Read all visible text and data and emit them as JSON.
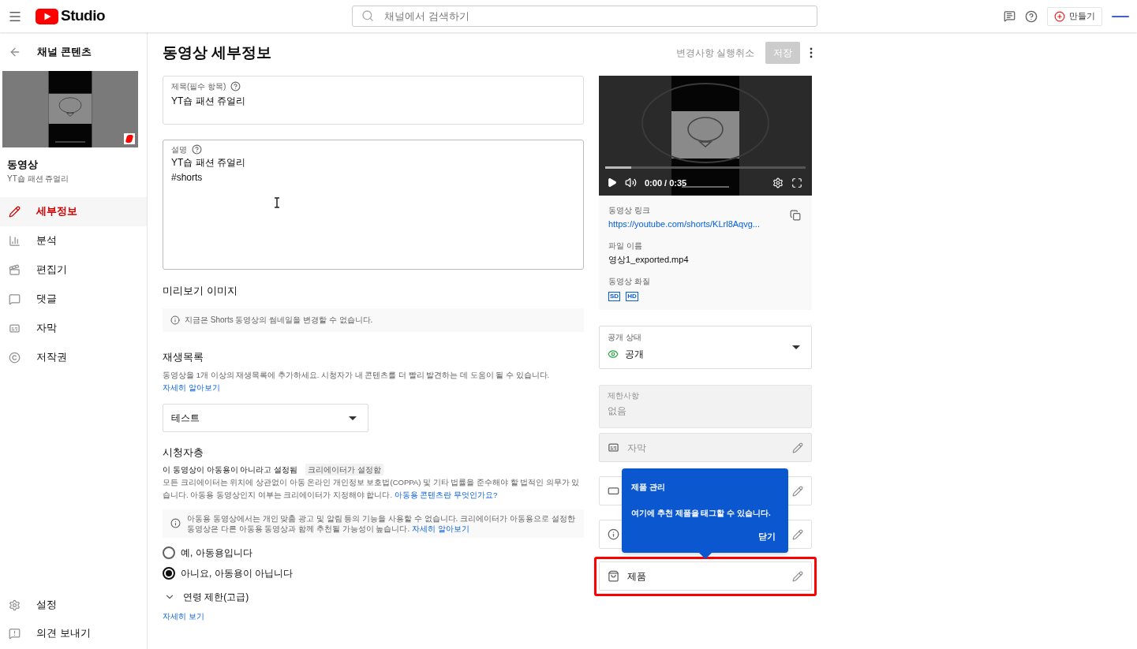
{
  "header": {
    "logo_text": "Studio",
    "search": {
      "placeholder": "채널에서 검색하기"
    },
    "create_button": "만들기"
  },
  "sidebar": {
    "back_label": "채널 콘텐츠",
    "video_label": "동영상",
    "video_title": "YT숍 패션 쥬얼리",
    "items": [
      {
        "kind": "details",
        "label": "세부정보",
        "selected": true
      },
      {
        "kind": "analytics",
        "label": "분석",
        "selected": false
      },
      {
        "kind": "editor",
        "label": "편집기",
        "selected": false
      },
      {
        "kind": "comments",
        "label": "댓글",
        "selected": false
      },
      {
        "kind": "subtitles",
        "label": "자막",
        "selected": false
      },
      {
        "kind": "copyright",
        "label": "저작권",
        "selected": false
      }
    ],
    "bottom_items": [
      {
        "kind": "settings",
        "label": "설정"
      },
      {
        "kind": "feedback",
        "label": "의견 보내기"
      }
    ]
  },
  "page": {
    "title": "동영상 세부정보",
    "undo_button": "변경사항 실행취소",
    "save_button": {
      "label": "저장",
      "disabled": true
    }
  },
  "title_field": {
    "label": "제목(필수 항목)",
    "value": "YT숍 패션 쥬얼리"
  },
  "description_field": {
    "label": "설명",
    "lines": [
      "YT숍 패션 쥬얼리",
      "#shorts"
    ]
  },
  "thumbnail_section": {
    "heading": "미리보기 이미지",
    "notice": "지금은 Shorts 동영상의 썸네일을 변경할 수 없습니다."
  },
  "playlist_section": {
    "heading": "재생목록",
    "description": "동영상을 1개 이상의 재생목록에 추가하세요. 시청자가 내 콘텐츠를 더 빨리 발견하는 데 도움이 될 수 있습니다.",
    "link": "자세히 알아보기",
    "selected_playlist": "테스트"
  },
  "audience_section": {
    "heading": "시청자층",
    "status": "이 동영상이 아동용이 아니라고 설정됨",
    "status_chip": "크리에이터가 설정함",
    "paragraph": "모든 크리에이터는 위치에 상관없이 아동 온라인 개인정보 보호법(COPPA) 및 기타 법률을 준수해야 할 법적인 의무가 있습니다. 아동용 동영상인지 여부는 크리에이터가 지정해야 합니다.",
    "paragraph_link": "아동용 콘텐츠란 무엇인가요?",
    "notice": "아동용 동영상에서는 개인 맞춤 광고 및 알림 등의 기능을 사용할 수 없습니다. 크리에이터가 아동용으로 설정한 동영상은 다른 아동용 동영상과 함께 추천될 가능성이 높습니다.",
    "notice_link": "자세히 알아보기",
    "options": [
      {
        "label": "예, 아동용입니다",
        "selected": false
      },
      {
        "label": "아니요, 아동용이 아닙니다",
        "selected": true
      }
    ],
    "age_restriction": {
      "label": "연령 제한(고급)",
      "expanded": false
    },
    "more_link": "자세히 보기"
  },
  "player": {
    "time": "0:00 / 0:35",
    "level": 0.13
  },
  "video_info": {
    "link_label": "동영상 링크",
    "link": "https://youtube.com/shorts/KLrl8Aqvg...",
    "file_label": "파일 이름",
    "file_name": "영상1_exported.mp4",
    "quality_label": "동영상 화질",
    "qualities": [
      "SD",
      "HD"
    ]
  },
  "visibility": {
    "label": "공개 상태",
    "value": "공개"
  },
  "restrictions": {
    "label": "제한사항",
    "value": "없음"
  },
  "feature_rows": [
    {
      "kind": "subtitles",
      "label": "자막",
      "disabled": true,
      "highlighted": false
    },
    {
      "kind": "endscreen",
      "disabled": false,
      "highlighted": false
    },
    {
      "kind": "info",
      "disabled": false,
      "highlighted": false
    },
    {
      "kind": "products",
      "label": "제품",
      "disabled": false,
      "highlighted": true
    }
  ],
  "tooltip": {
    "title": "제품 관리",
    "body": "여기에 추천 제품을 태그할 수 있습니다.",
    "close": "닫기"
  }
}
